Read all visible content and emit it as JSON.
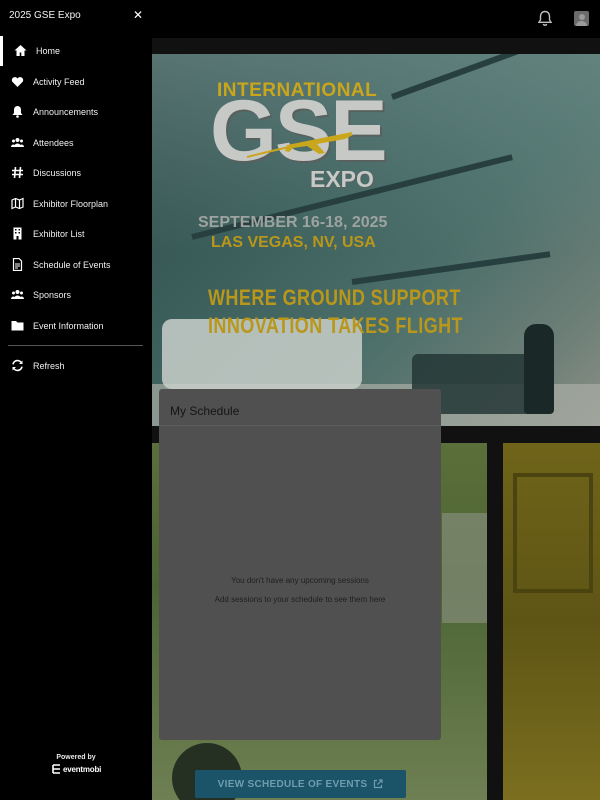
{
  "app": {
    "title": "2025 GSE Expo"
  },
  "sidebar": {
    "items": [
      {
        "label": "Home",
        "icon": "home-icon"
      },
      {
        "label": "Activity Feed",
        "icon": "heart-icon"
      },
      {
        "label": "Announcements",
        "icon": "bell-icon"
      },
      {
        "label": "Attendees",
        "icon": "people-icon"
      },
      {
        "label": "Discussions",
        "icon": "hashtag-icon"
      },
      {
        "label": "Exhibitor Floorplan",
        "icon": "map-icon"
      },
      {
        "label": "Exhibitor List",
        "icon": "building-icon"
      },
      {
        "label": "Schedule of Events",
        "icon": "document-icon"
      },
      {
        "label": "Sponsors",
        "icon": "people-icon"
      },
      {
        "label": "Event Information",
        "icon": "folder-icon"
      }
    ],
    "refresh_label": "Refresh",
    "powered_by": "Powered by",
    "brand": "eventmobi"
  },
  "banner": {
    "logo_top": "INTERNATIONAL",
    "logo_main": "GSE",
    "logo_sub": "EXPO",
    "dates": "SEPTEMBER 16-18, 2025",
    "location": "LAS VEGAS, NV, USA",
    "tagline_1": "WHERE GROUND SUPPORT",
    "tagline_2": "INNOVATION TAKES FLIGHT"
  },
  "schedule": {
    "title": "My Schedule",
    "empty_line_1": "You don't have any upcoming sessions",
    "empty_line_2": "Add sessions to your schedule to see them here"
  },
  "cta": {
    "label": "VIEW SCHEDULE OF EVENTS"
  },
  "colors": {
    "sidebar_bg": "#000000",
    "accent_gold": "#c9a61b",
    "cta_bg": "#1b5368"
  }
}
